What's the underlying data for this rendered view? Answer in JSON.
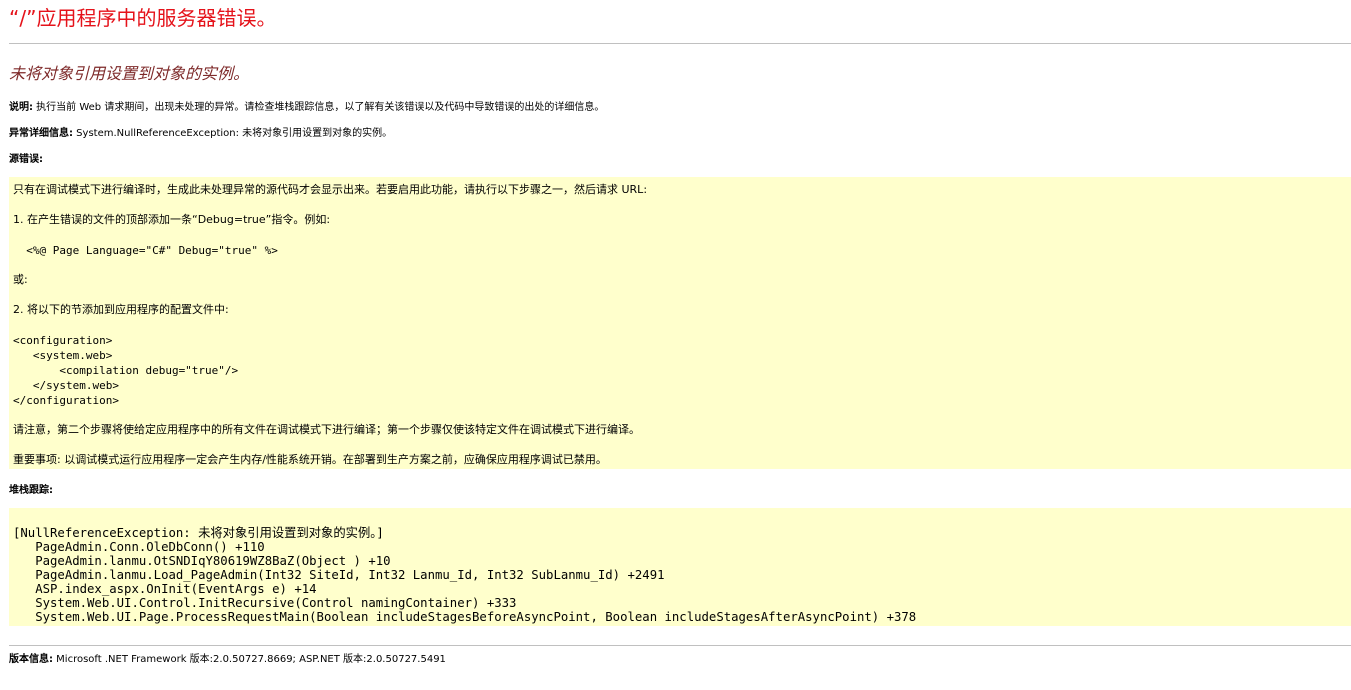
{
  "page": {
    "title": "“/”应用程序中的服务器错误。",
    "message": "未将对象引用设置到对象的实例。"
  },
  "description": {
    "label": "说明:",
    "text": " 执行当前 Web 请求期间，出现未处理的异常。请检查堆栈跟踪信息，以了解有关该错误以及代码中导致错误的出处的详细信息。"
  },
  "exception_details": {
    "label": "异常详细信息:",
    "text": " System.NullReferenceException: 未将对象引用设置到对象的实例。"
  },
  "source_error": {
    "label": "源错误:",
    "intro": "只有在调试模式下进行编译时，生成此未处理异常的源代码才会显示出来。若要启用此功能，请执行以下步骤之一，然后请求 URL:",
    "step1": "1. 在产生错误的文件的顶部添加一条“Debug=true”指令。例如:",
    "step1_code": "  <%@ Page Language=\"C#\" Debug=\"true\" %>",
    "or": "或:",
    "step2": "2. 将以下的节添加到应用程序的配置文件中:",
    "config_lines": [
      "<configuration>",
      "   <system.web>",
      "       <compilation debug=\"true\"/>",
      "   </system.web>",
      "</configuration>"
    ],
    "note": "请注意，第二个步骤将使给定应用程序中的所有文件在调试模式下进行编译；第一个步骤仅使该特定文件在调试模式下进行编译。",
    "important": "重要事项: 以调试模式运行应用程序一定会产生内存/性能系统开销。在部署到生产方案之前，应确保应用程序调试已禁用。"
  },
  "stack_trace": {
    "label": "堆栈跟踪:",
    "lines": [
      "[NullReferenceException: 未将对象引用设置到对象的实例。]",
      "   PageAdmin.Conn.OleDbConn() +110",
      "   PageAdmin.lanmu.OtSNDIqY80619WZ8BaZ(Object ) +10",
      "   PageAdmin.lanmu.Load_PageAdmin(Int32 SiteId, Int32 Lanmu_Id, Int32 SubLanmu_Id) +2491",
      "   ASP.index_aspx.OnInit(EventArgs e) +14",
      "   System.Web.UI.Control.InitRecursive(Control namingContainer) +333",
      "   System.Web.UI.Page.ProcessRequestMain(Boolean includeStagesBeforeAsyncPoint, Boolean includeStagesAfterAsyncPoint) +378"
    ]
  },
  "version": {
    "label": "版本信息:",
    "text": " Microsoft .NET Framework 版本:2.0.50727.8669; ASP.NET 版本:2.0.50727.5491"
  },
  "colors": {
    "title": "#e5121a",
    "message": "#7e2a2a",
    "panel_background": "#ffffcc",
    "rule": "#c0c0c0"
  }
}
